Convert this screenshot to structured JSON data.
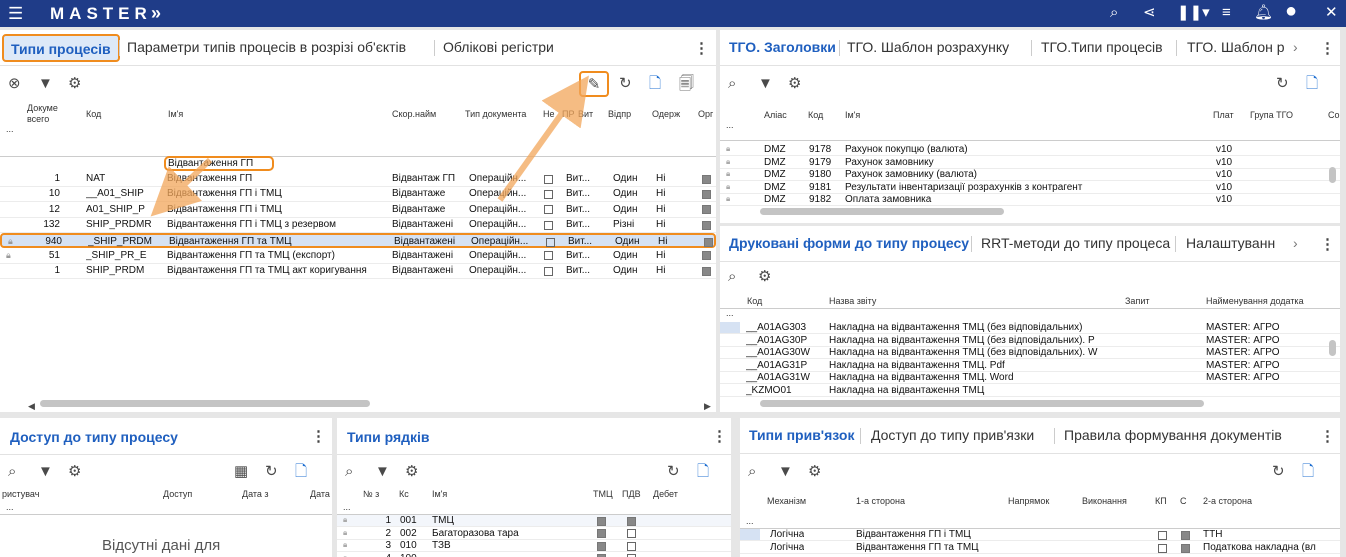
{
  "topbar": {
    "brand": "MASTER",
    "expand": "»",
    "menu_icon": "hamburger-icon",
    "icons": [
      "search-icon",
      "share-icon",
      "pause-icon",
      "filter-settings-icon",
      "bell-icon",
      "account-icon",
      "close-icon"
    ],
    "accent": "#1f3c88"
  },
  "panel_types": {
    "tabs": [
      "Типи процесів",
      "Параметри типів процесів в розрізі об'єктів",
      "Облікові регістри"
    ],
    "columns": [
      "Докуме всего",
      "Код",
      "Ім'я",
      "Скор.найм",
      "Тип документа",
      "Не",
      "ПР",
      "Вит",
      "Відпр",
      "Одерж",
      "Орг"
    ],
    "filter_value": "Відвантаження ГП",
    "rows": [
      {
        "count": "1",
        "code": "NAT",
        "name": "Відвантаження ГП",
        "short": "Відвантаж ГП",
        "doctype": "Операційн...",
        "vit": "Вит...",
        "send": "Один",
        "recv": "Ні"
      },
      {
        "count": "10",
        "code": "__A01_SHIP",
        "name": "Відвантаження ГП і ТМЦ",
        "short": "Відвантаже",
        "doctype": "Операційн...",
        "vit": "Вит...",
        "send": "Один",
        "recv": "Ні"
      },
      {
        "count": "12",
        "code": "A01_SHIP_P",
        "name": "Відвантаження ГП і ТМЦ",
        "short": "Відвантаже",
        "doctype": "Операційн...",
        "vit": "Вит...",
        "send": "Один",
        "recv": "Ні"
      },
      {
        "count": "132",
        "code": "SHIP_PRDMR",
        "name": "Відвантаження ГП і ТМЦ з резервом",
        "short": "Відвантажені",
        "doctype": "Операційн...",
        "vit": "Вит...",
        "send": "Різні",
        "recv": "Ні"
      },
      {
        "count": "940",
        "code": "_SHIP_PRDM",
        "name": "Відвантаження ГП та ТМЦ",
        "short": "Відвантажені",
        "doctype": "Операційн...",
        "vit": "Вит...",
        "send": "Один",
        "recv": "Ні"
      },
      {
        "count": "51",
        "code": "_SHIP_PR_E",
        "name": "Відвантаження ГП та ТМЦ (експорт)",
        "short": "Відвантажені",
        "doctype": "Операційн...",
        "vit": "Вит...",
        "send": "Один",
        "recv": "Ні"
      },
      {
        "count": "1",
        "code": "SHIP_PRDM",
        "name": "Відвантаження ГП та ТМЦ акт коригування",
        "short": "Відвантажені",
        "doctype": "Операційн...",
        "vit": "Вит...",
        "send": "Один",
        "recv": "Ні"
      }
    ]
  },
  "panel_tgo": {
    "tabs": [
      "ТГО. Заголовки",
      "ТГО. Шаблон розрахунку",
      "ТГО.Типи процесів",
      "ТГО. Шаблон р"
    ],
    "columns": [
      "Аліас",
      "Код",
      "Ім'я",
      "Плат",
      "Група ТГО",
      "Со ТХ"
    ],
    "rows": [
      {
        "alias": "DMZ",
        "code": "9178",
        "name": "Рахунок покупцю (валюта)",
        "plat": "v10"
      },
      {
        "alias": "DMZ",
        "code": "9179",
        "name": "Рахунок замовнику",
        "plat": "v10"
      },
      {
        "alias": "DMZ",
        "code": "9180",
        "name": "Рахунок замовнику (валюта)",
        "plat": "v10"
      },
      {
        "alias": "DMZ",
        "code": "9181",
        "name": "Результати інвентаризації розрахунків з контрагент",
        "plat": "v10"
      },
      {
        "alias": "DMZ",
        "code": "9182",
        "name": "Оплата замовника",
        "plat": "v10"
      }
    ]
  },
  "panel_print": {
    "tabs": [
      "Друковані форми до типу процесу",
      "RRT-методи до типу процеса",
      "Налаштуванн"
    ],
    "columns": [
      "Код",
      "Назва звіту",
      "Запит",
      "Найменування додатка"
    ],
    "rows": [
      {
        "code": "__A01AG303",
        "name": "Накладна на відвантаження ТМЦ (без відповідальних)",
        "app": "MASTER: АГРО"
      },
      {
        "code": "__A01AG30P",
        "name": "Накладна на відвантаження ТМЦ (без відповідальних). P",
        "app": "MASTER: АГРО"
      },
      {
        "code": "__A01AG30W",
        "name": "Накладна на відвантаження ТМЦ (без відповідальних). W",
        "app": "MASTER: АГРО"
      },
      {
        "code": "__A01AG31P",
        "name": "Накладна на відвантаження ТМЦ. Pdf",
        "app": "MASTER: АГРО"
      },
      {
        "code": "__A01AG31W",
        "name": "Накладна на відвантаження ТМЦ. Word",
        "app": "MASTER: АГРО"
      },
      {
        "code": "_KZMO01",
        "name": "Накладна на відвантаження ТМЦ",
        "app": ""
      }
    ]
  },
  "panel_access": {
    "title": "Доступ до типу процесу",
    "columns": [
      "ристувач",
      "Доступ",
      "Дата з",
      "Дата"
    ],
    "empty": "Відсутні дані для"
  },
  "panel_lines": {
    "title": "Типи рядків",
    "columns": [
      "№ з",
      "Кс",
      "Ім'я",
      "ТМЦ",
      "ПДВ",
      "Дебет"
    ],
    "rows": [
      {
        "n": "1",
        "k": "001",
        "name": "ТМЦ"
      },
      {
        "n": "2",
        "k": "002",
        "name": "Багаторазова тара"
      },
      {
        "n": "3",
        "k": "010",
        "name": "ТЗВ"
      },
      {
        "n": "4",
        "k": "100",
        "name": ""
      }
    ]
  },
  "panel_links": {
    "tabs": [
      "Типи прив'язок",
      "Доступ до типу прив'язки",
      "Правила формування документів"
    ],
    "columns": [
      "Механізм",
      "1-а сторона",
      "Напрямок",
      "Виконання",
      "КП",
      "С",
      "2-а сторона"
    ],
    "rows": [
      {
        "mech": "Логічна",
        "side1": "Відвантаження ГП і ТМЦ",
        "side2": "ТТН"
      },
      {
        "mech": "Логічна",
        "side1": "Відвантаження ГП та ТМЦ",
        "side2": "Податкова накладна (вл"
      }
    ]
  }
}
